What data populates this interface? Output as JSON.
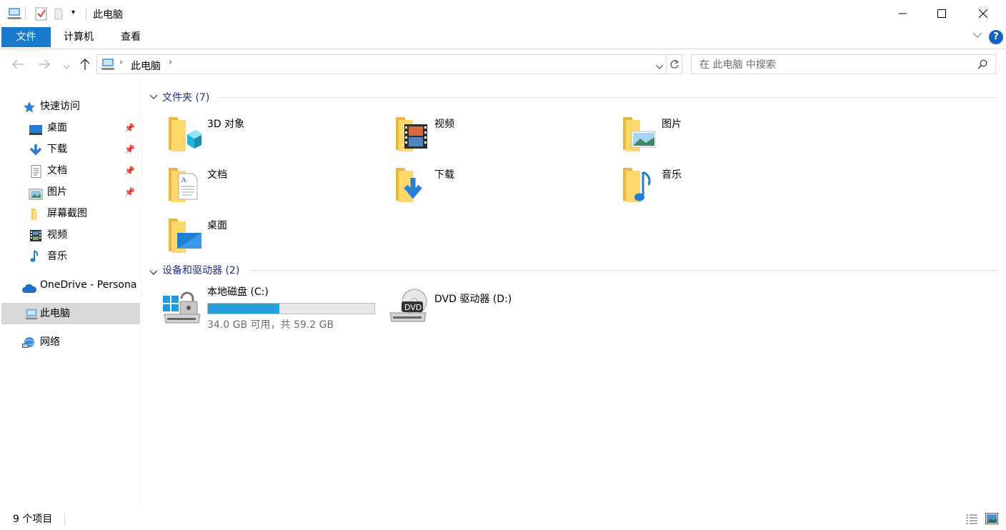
{
  "window": {
    "title": "此电脑",
    "controls": [
      "minimize-icon",
      "maximize-icon",
      "close-icon"
    ]
  },
  "ribbon": {
    "tabs": [
      {
        "label": "文件",
        "active": true
      },
      {
        "label": "计算机"
      },
      {
        "label": "查看"
      }
    ],
    "accent": "#1979ca"
  },
  "nav": {
    "path": [
      "此电脑"
    ],
    "search_placeholder": "在 此电脑 中搜索"
  },
  "sidebar": {
    "quick_access": "快速访问",
    "items": [
      {
        "label": "桌面",
        "icon": "desktop-icon",
        "pinned": true
      },
      {
        "label": "下载",
        "icon": "download-icon",
        "pinned": true
      },
      {
        "label": "文档",
        "icon": "document-icon",
        "pinned": true
      },
      {
        "label": "图片",
        "icon": "picture-icon",
        "pinned": true
      },
      {
        "label": "屏幕截图",
        "icon": "folder-icon",
        "pinned": false
      },
      {
        "label": "视频",
        "icon": "video-icon",
        "pinned": false
      },
      {
        "label": "音乐",
        "icon": "music-icon",
        "pinned": false
      }
    ],
    "onedrive": "OneDrive - Persona",
    "this_pc": "此电脑",
    "network": "网络"
  },
  "folders": {
    "header": "文件夹 (7)",
    "items": [
      {
        "label": "3D 对象",
        "icon": "3d-objects-folder-icon"
      },
      {
        "label": "视频",
        "icon": "videos-folder-icon"
      },
      {
        "label": "图片",
        "icon": "pictures-folder-icon"
      },
      {
        "label": "文档",
        "icon": "documents-folder-icon"
      },
      {
        "label": "下载",
        "icon": "downloads-folder-icon"
      },
      {
        "label": "音乐",
        "icon": "music-folder-icon"
      },
      {
        "label": "桌面",
        "icon": "desktop-folder-icon"
      }
    ]
  },
  "drives": {
    "header": "设备和驱动器 (2)",
    "items": [
      {
        "label": "本地磁盘 (C:)",
        "icon": "local-disk-icon",
        "usage_fraction": 0.43,
        "free_text": "34.0 GB 可用，共 59.2 GB"
      },
      {
        "label": "DVD 驱动器 (D:)",
        "icon": "dvd-drive-icon",
        "dvd_badge": "DVD"
      }
    ]
  },
  "status": {
    "count": "9 个项目"
  }
}
